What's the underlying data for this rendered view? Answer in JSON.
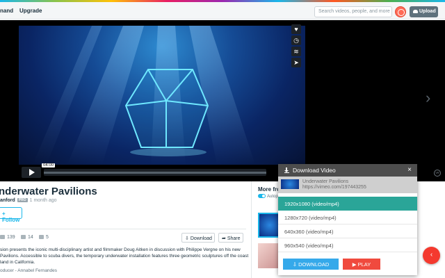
{
  "header": {
    "nav": [
      "nand",
      "Upgrade"
    ],
    "search_placeholder": "Search videos, people, and more",
    "upload_label": "Upload"
  },
  "player": {
    "time": "04:00",
    "side_icons": [
      "heart-icon",
      "clock-icon",
      "layers-icon",
      "send-icon"
    ],
    "badge": "ve"
  },
  "video": {
    "title": "nderwater Pavilions",
    "author": "anford",
    "pro_badge": "PRO",
    "ago": "1 month ago",
    "follow_label": "+ Follow",
    "plays": "139",
    "collections": "14",
    "comments": "5",
    "download_label": "Download",
    "share_label": "Share",
    "description": "sion presents the iconic multi-disciplinary artist and filmmaker Doug Aitken in discussion with Philippe Vergne on his new Pavilions. Accessible to scuba divers, the temporary underwater installation features three geometric sculptures off the coast land in California.",
    "producer": "oducer - Annabel Fernandes"
  },
  "more": {
    "title": "More fro",
    "autoplay": "Autopl"
  },
  "download_panel": {
    "title": "Download Video",
    "close": "×",
    "video_title": "Underwater Pavilions",
    "video_url": "https://vimeo.com/197443255",
    "formats": [
      "1920x1080 (video/mp4)",
      "1280x720 (video/mp4)",
      "640x360 (video/mp4)",
      "960x540 (video/mp4)"
    ],
    "selected_index": 0,
    "download_button": "DOWNLOAD",
    "play_button": "PLAY",
    "download_button_color": "#35a9ea",
    "play_button_color": "#f04a3e",
    "selected_color": "#2aa598"
  },
  "colors": {
    "accent": "#1ab7ea",
    "fab": "#f4392e"
  }
}
